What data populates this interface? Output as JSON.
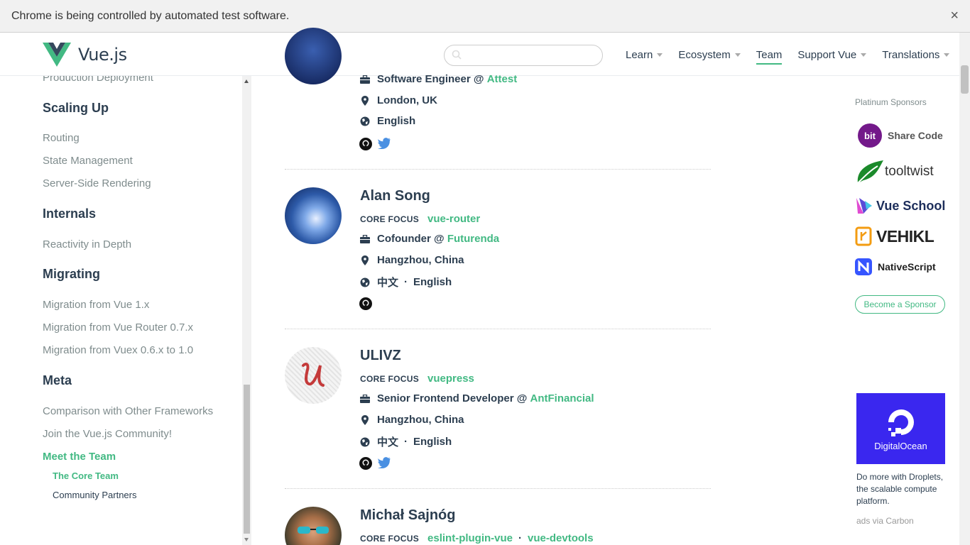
{
  "infobar": {
    "message": "Chrome is being controlled by automated test software.",
    "close": "×"
  },
  "header": {
    "logo_text": "Vue.js",
    "search_placeholder": "",
    "nav": [
      {
        "label": "Learn",
        "dropdown": true
      },
      {
        "label": "Ecosystem",
        "dropdown": true
      },
      {
        "label": "Team",
        "dropdown": false,
        "active": true
      },
      {
        "label": "Support Vue",
        "dropdown": true
      },
      {
        "label": "Translations",
        "dropdown": true
      }
    ]
  },
  "sidebar": {
    "partial_top": "Production Deployment",
    "scaling_up": "Scaling Up",
    "routing": "Routing",
    "state_management": "State Management",
    "ssr": "Server-Side Rendering",
    "internals": "Internals",
    "reactivity": "Reactivity in Depth",
    "migrating": "Migrating",
    "mig_vue": "Migration from Vue 1.x",
    "mig_router": "Migration from Vue Router 0.7.x",
    "mig_vuex": "Migration from Vuex 0.6.x to 1.0",
    "meta": "Meta",
    "comparison": "Comparison with Other Frameworks",
    "community": "Join the Vue.js Community!",
    "meet_team": "Meet the Team",
    "core_team": "The Core Team",
    "community_partners": "Community Partners"
  },
  "members": {
    "m0": {
      "job": "Software Engineer",
      "at": "@",
      "company": "Attest",
      "location": "London, UK",
      "languages": [
        "English"
      ]
    },
    "m1": {
      "name": "Alan Song",
      "focus_label": "CORE FOCUS",
      "focus": [
        "vue-router"
      ],
      "job": "Cofounder",
      "at": "@",
      "company": "Futurenda",
      "location": "Hangzhou, China",
      "languages": [
        "中文",
        "English"
      ],
      "dot": "·"
    },
    "m2": {
      "name": "ULIVZ",
      "focus_label": "CORE FOCUS",
      "focus": [
        "vuepress"
      ],
      "job": "Senior Frontend Developer",
      "at": "@",
      "company": "AntFinancial",
      "location": "Hangzhou, China",
      "languages": [
        "中文",
        "English"
      ],
      "dot": "·"
    },
    "m3": {
      "name": "Michał Sajnóg",
      "focus_label": "CORE FOCUS",
      "focus": [
        "eslint-plugin-vue",
        "vue-devtools"
      ],
      "dot": "·"
    }
  },
  "sponsors": {
    "title": "Platinum Sponsors",
    "bit": "Share Code",
    "bit_logo": "bit",
    "tooltwist": "tooltwist",
    "vueschool": "Vue School",
    "vehikl": "VEHIKL",
    "nativescript": "NativeScript",
    "become": "Become a Sponsor"
  },
  "ad": {
    "brand": "DigitalOcean",
    "text": "Do more with Droplets, the scalable compute platform.",
    "via": "ads via Carbon"
  },
  "colors": {
    "accent": "#42b983",
    "text": "#2c3e50",
    "muted": "#7f8c8d",
    "twitter": "#4a90e2",
    "digitalocean": "#3a27ef"
  }
}
